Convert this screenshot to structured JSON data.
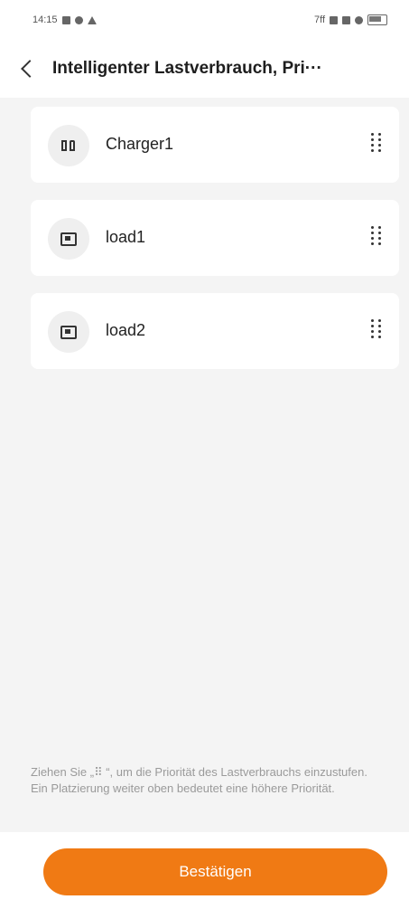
{
  "status_bar": {
    "time": "14:15",
    "right_text": "7ff"
  },
  "header": {
    "title": "Intelligenter Lastverbrauch, Pri···"
  },
  "devices": [
    {
      "label": "Charger1",
      "icon": "charger-icon"
    },
    {
      "label": "load1",
      "icon": "load-device-icon"
    },
    {
      "label": "load2",
      "icon": "load-device-icon"
    }
  ],
  "hint": {
    "text": "Ziehen Sie „⠿ “, um die Priorität des Lastverbrauchs einzustufen. Ein Platzierung weiter oben bedeutet eine höhere Priorität."
  },
  "footer": {
    "confirm_label": "Bestätigen"
  },
  "colors": {
    "accent": "#f07a14",
    "background": "#f4f4f4",
    "card": "#ffffff"
  }
}
